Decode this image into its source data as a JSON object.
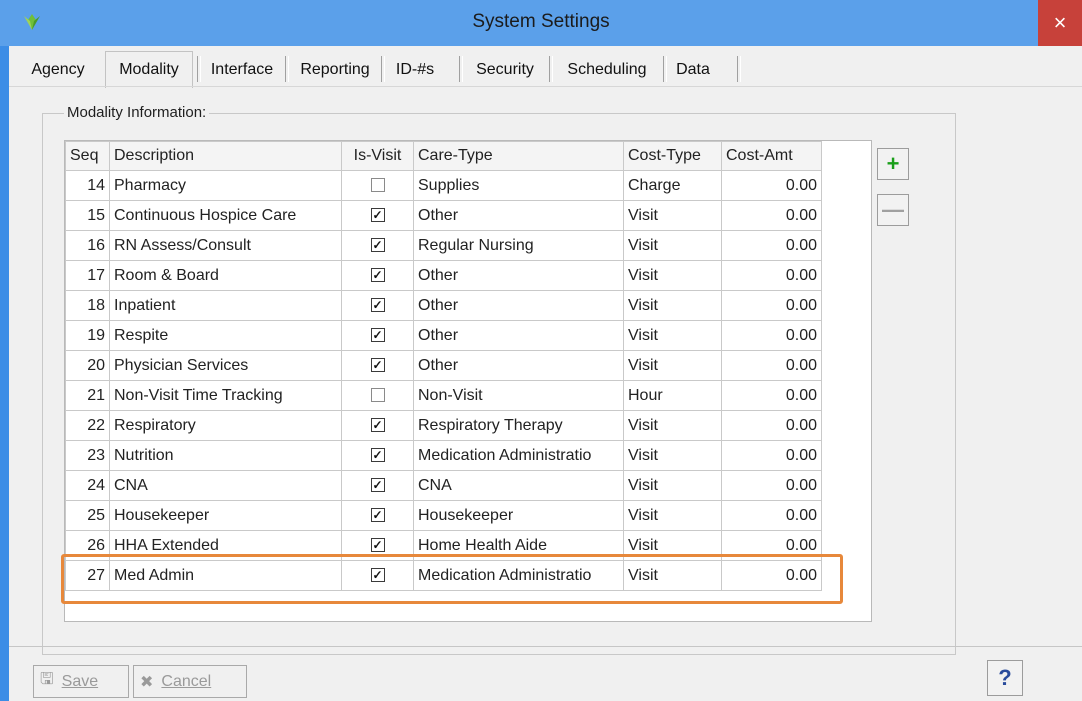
{
  "window": {
    "title": "System Settings",
    "close_glyph": "×"
  },
  "tabs": [
    {
      "label": "Agency"
    },
    {
      "label": "Modality",
      "active": true
    },
    {
      "label": "Interface"
    },
    {
      "label": "Reporting"
    },
    {
      "label": "ID-#s"
    },
    {
      "label": "Security"
    },
    {
      "label": "Scheduling"
    },
    {
      "label": "Data"
    }
  ],
  "group": {
    "legend": "Modality Information:"
  },
  "grid": {
    "columns": [
      "Seq",
      "Description",
      "Is-Visit",
      "Care-Type",
      "Cost-Type",
      "Cost-Amt"
    ],
    "rows": [
      {
        "seq": "14",
        "desc": "Pharmacy",
        "visit": false,
        "care": "Supplies",
        "costtype": "Charge",
        "amt": "0.00"
      },
      {
        "seq": "15",
        "desc": "Continuous Hospice Care",
        "visit": true,
        "care": "Other",
        "costtype": "Visit",
        "amt": "0.00"
      },
      {
        "seq": "16",
        "desc": "RN Assess/Consult",
        "visit": true,
        "care": "Regular Nursing",
        "costtype": "Visit",
        "amt": "0.00"
      },
      {
        "seq": "17",
        "desc": "Room & Board",
        "visit": true,
        "care": "Other",
        "costtype": "Visit",
        "amt": "0.00"
      },
      {
        "seq": "18",
        "desc": "Inpatient",
        "visit": true,
        "care": "Other",
        "costtype": "Visit",
        "amt": "0.00"
      },
      {
        "seq": "19",
        "desc": "Respite",
        "visit": true,
        "care": "Other",
        "costtype": "Visit",
        "amt": "0.00"
      },
      {
        "seq": "20",
        "desc": "Physician Services",
        "visit": true,
        "care": "Other",
        "costtype": "Visit",
        "amt": "0.00"
      },
      {
        "seq": "21",
        "desc": "Non-Visit Time Tracking",
        "visit": false,
        "care": "Non-Visit",
        "costtype": "Hour",
        "amt": "0.00"
      },
      {
        "seq": "22",
        "desc": "Respiratory",
        "visit": true,
        "care": "Respiratory Therapy",
        "costtype": "Visit",
        "amt": "0.00"
      },
      {
        "seq": "23",
        "desc": "Nutrition",
        "visit": true,
        "care": "Medication Administratio",
        "costtype": "Visit",
        "amt": "0.00"
      },
      {
        "seq": "24",
        "desc": "CNA",
        "visit": true,
        "care": "CNA",
        "costtype": "Visit",
        "amt": "0.00"
      },
      {
        "seq": "25",
        "desc": "Housekeeper",
        "visit": true,
        "care": "Housekeeper",
        "costtype": "Visit",
        "amt": "0.00"
      },
      {
        "seq": "26",
        "desc": "HHA Extended",
        "visit": true,
        "care": "Home Health Aide",
        "costtype": "Visit",
        "amt": "0.00"
      },
      {
        "seq": "27",
        "desc": "Med Admin",
        "visit": true,
        "care": "Medication Administratio",
        "costtype": "Visit",
        "amt": "0.00"
      }
    ]
  },
  "side_buttons": {
    "add_glyph": "+",
    "remove_glyph": "—"
  },
  "buttons": {
    "save": {
      "label": "Save",
      "icon": "floppy-icon",
      "glyph": "🖫"
    },
    "cancel": {
      "label": "Cancel",
      "icon": "x-icon",
      "glyph": "✖"
    },
    "help_glyph": "?"
  },
  "colors": {
    "titlebar": "#5ba0ea",
    "close": "#c7413a",
    "highlight": "#e7883b",
    "add": "#1a9f1a"
  }
}
